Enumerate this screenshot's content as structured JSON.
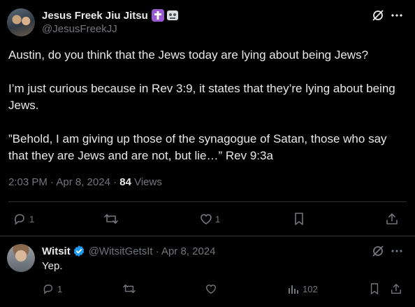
{
  "main_tweet": {
    "author_name": "Jesus Freek Jiu Jitsu",
    "author_handle": "@JesusFreekJJ",
    "paragraphs": [
      "Austin, do you think that the Jews today are lying about being Jews?",
      "I’m just curious because in Rev 3:9, it states that they’re lying about being Jews.",
      "”Behold, I am giving up those of the synagogue of Satan, those who say that they are Jews and are not, but lie…” Rev 9:3a"
    ],
    "timestamp": "2:03 PM · Apr 8, 2024 · ",
    "views_count": "84",
    "views_label": " Views",
    "actions": {
      "reply_count": "1",
      "retweet_count": "",
      "like_count": "1"
    }
  },
  "reply": {
    "author_name": "Witsit",
    "author_handle": "@WitsitGetsIt",
    "date": "· Apr 8, 2024",
    "text": "Yep.",
    "actions": {
      "reply_count": "1",
      "views_count": "102"
    }
  },
  "icons": {
    "author_badges": [
      "cross-emoji",
      "martial-arts-emoji"
    ],
    "verified": "verified-badge-icon",
    "grok": "grok-icon",
    "more": "more-icon"
  },
  "colors": {
    "background": "#000000",
    "text_primary": "#e7e9ea",
    "text_muted": "#71767b",
    "divider": "#2f3336",
    "verified_blue": "#1d9bf0",
    "cross_badge": "#9b59d0"
  }
}
